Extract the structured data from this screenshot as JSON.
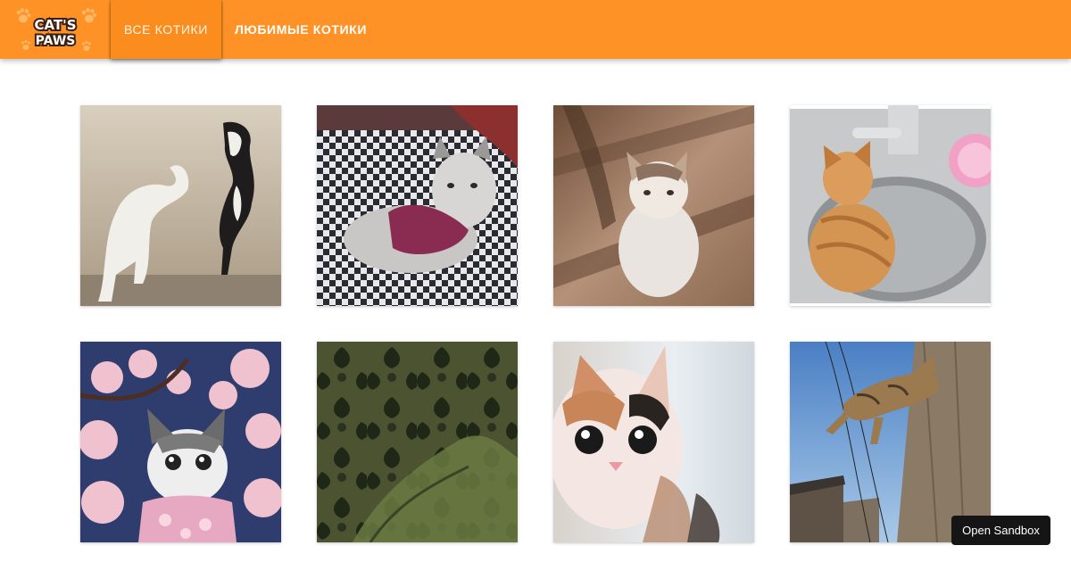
{
  "header": {
    "logo_text_top": "CAT'S",
    "logo_text_bottom": "PAWS",
    "tabs": [
      {
        "label": "Все котики",
        "active": true
      },
      {
        "label": "Любимые котики",
        "active": false
      }
    ]
  },
  "gallery": {
    "cats": [
      {
        "subject": "white and black cats on sand"
      },
      {
        "subject": "fluffy persian cat in sweater on checkered couch"
      },
      {
        "subject": "tabby white cat on wooden floor"
      },
      {
        "subject": "ginger kitten in kitchen sink"
      },
      {
        "subject": "cat among cherry blossoms"
      },
      {
        "subject": "green patterned fabric close-up"
      },
      {
        "subject": "calico kitten face"
      },
      {
        "subject": "tabby cat leaping from wall"
      }
    ]
  },
  "sandbox_button": {
    "label": "Open Sandbox"
  },
  "colors": {
    "accent": "#ff9226",
    "tab_active": "#fb8d1f",
    "sandbox_bg": "#151515"
  }
}
